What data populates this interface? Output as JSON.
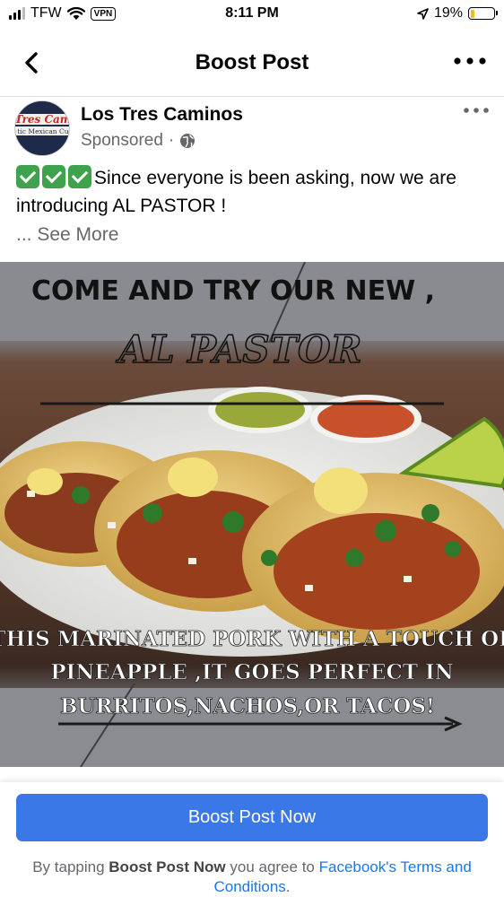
{
  "status_bar": {
    "carrier": "TFW",
    "vpn": "VPN",
    "time": "8:11 PM",
    "battery": "19%",
    "battery_level": 0.19,
    "battery_color": "#f2c200"
  },
  "header": {
    "title": "Boost Post",
    "back_icon": "chevron-left-icon",
    "more_icon": "more-horizontal-icon"
  },
  "post": {
    "page_name": "Los Tres Caminos",
    "avatar_text": "Tres Cam",
    "avatar_subtext": "tic Mexican Cu",
    "sponsored": "Sponsored",
    "text": "Since everyone is been asking, now we are introducing AL PASTOR !",
    "see_more_prefix": "...",
    "see_more": "See More",
    "check_count": 3
  },
  "ad_image": {
    "headline": "COME AND TRY OUR NEW ,",
    "title": "AL PASTOR",
    "caption_line1": "THIS MARINATED PORK WITH A TOUCH OF",
    "caption_line2": "PINEAPPLE ,IT GOES  PERFECT IN",
    "caption_line3": "BURRITOS,NACHOS,OR TACOS!"
  },
  "footer": {
    "button_label": "Boost Post Now",
    "terms_prefix": "By tapping",
    "terms_button_ref": "Boost Post Now",
    "terms_middle": "you agree to",
    "terms_link": "Facebook's Terms and Conditions",
    "terms_suffix": "."
  },
  "colors": {
    "accent": "#3b78e7",
    "link": "#1877f2",
    "muted": "#65676b"
  }
}
